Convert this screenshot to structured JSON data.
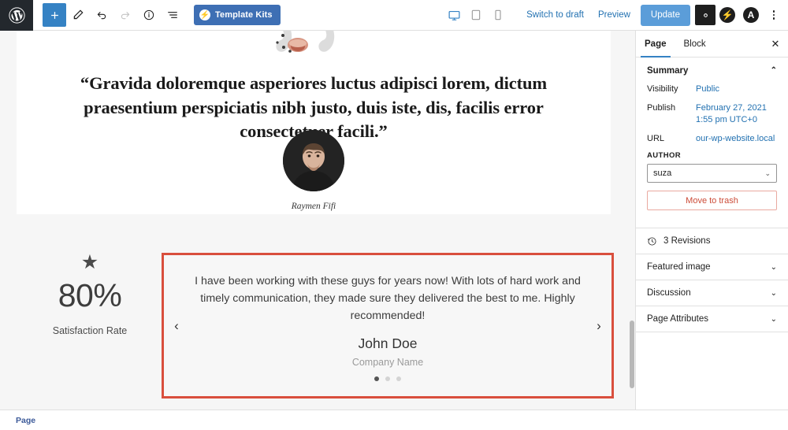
{
  "topbar": {
    "logo_icon": "wordpress-logo-icon",
    "left_tools": [
      {
        "name": "add-block-button",
        "icon": "plus-icon",
        "label": "+",
        "style": "primary"
      },
      {
        "name": "edit-tool-button",
        "icon": "pencil-icon",
        "label": "",
        "style": "plain"
      },
      {
        "name": "undo-button",
        "icon": "undo-icon",
        "label": "",
        "style": "plain"
      },
      {
        "name": "redo-button",
        "icon": "redo-icon",
        "label": "",
        "style": "disabled"
      },
      {
        "name": "details-button",
        "icon": "info-icon",
        "label": "",
        "style": "plain"
      },
      {
        "name": "list-view-button",
        "icon": "list-view-icon",
        "label": "",
        "style": "plain"
      }
    ],
    "template_kits_label": "Template Kits",
    "template_kits_icon": "bolt-icon",
    "devices": [
      {
        "name": "desktop-preview-button",
        "icon": "desktop-icon",
        "active": true
      },
      {
        "name": "tablet-preview-button",
        "icon": "tablet-icon",
        "active": false
      },
      {
        "name": "mobile-preview-button",
        "icon": "mobile-icon",
        "active": false
      }
    ],
    "switch_to_draft_label": "Switch to draft",
    "preview_label": "Preview",
    "update_label": "Update",
    "settings_icon": "gear-icon",
    "jetpack_icon": "jetpack-bolt-icon",
    "astra_icon": "astra-icon",
    "more_menu_icon": "kebab-menu-icon"
  },
  "canvas": {
    "decoration_icon": "quotation-mark-graphic",
    "quote_text": "“Gravida doloremque asperiores luctus adipisci lorem, dictum praesentium perspiciatis nibh justo, duis iste, dis, facilis error consectetuer facili.”",
    "avatar_icon": "person-portrait-avatar",
    "avatar_name": "Raymen Fifi",
    "stat": {
      "icon": "star-icon",
      "star_glyph": "★",
      "value": "80%",
      "label": "Satisfaction Rate"
    },
    "testimonial": {
      "text": "I have been working with these guys for years now! With lots of hard work and timely communication, they made sure they delivered the best to me. Highly recommended!",
      "name": "John Doe",
      "company": "Company Name",
      "prev_arrow": "‹",
      "next_arrow": "›",
      "dots_total": 3,
      "dots_active_index": 0,
      "selected_border_color": "#d94f3d"
    },
    "appender_label": "+"
  },
  "sidebar": {
    "tabs": [
      {
        "name": "tab-page",
        "label": "Page",
        "active": true
      },
      {
        "name": "tab-block",
        "label": "Block",
        "active": false
      }
    ],
    "close_glyph": "✕",
    "summary": {
      "title": "Summary",
      "chevron": "⌃",
      "rows": [
        {
          "key": "Visibility",
          "value": "Public"
        },
        {
          "key": "Publish",
          "value": "February 27, 2021 1:55 pm UTC+0"
        },
        {
          "key": "URL",
          "value": "our-wp-website.local"
        }
      ],
      "author_label": "AUTHOR",
      "author_value": "suza",
      "author_chevron": "⌄",
      "trash_label": "Move to trash"
    },
    "revisions": {
      "icon": "revisions-clock-icon",
      "label": "3 Revisions"
    },
    "panels": [
      {
        "name": "panel-featured-image",
        "label": "Featured image",
        "chevron": "⌄"
      },
      {
        "name": "panel-discussion",
        "label": "Discussion",
        "chevron": "⌄"
      },
      {
        "name": "panel-page-attributes",
        "label": "Page Attributes",
        "chevron": "⌄"
      }
    ]
  },
  "bottombar": {
    "breadcrumb": "Page"
  }
}
